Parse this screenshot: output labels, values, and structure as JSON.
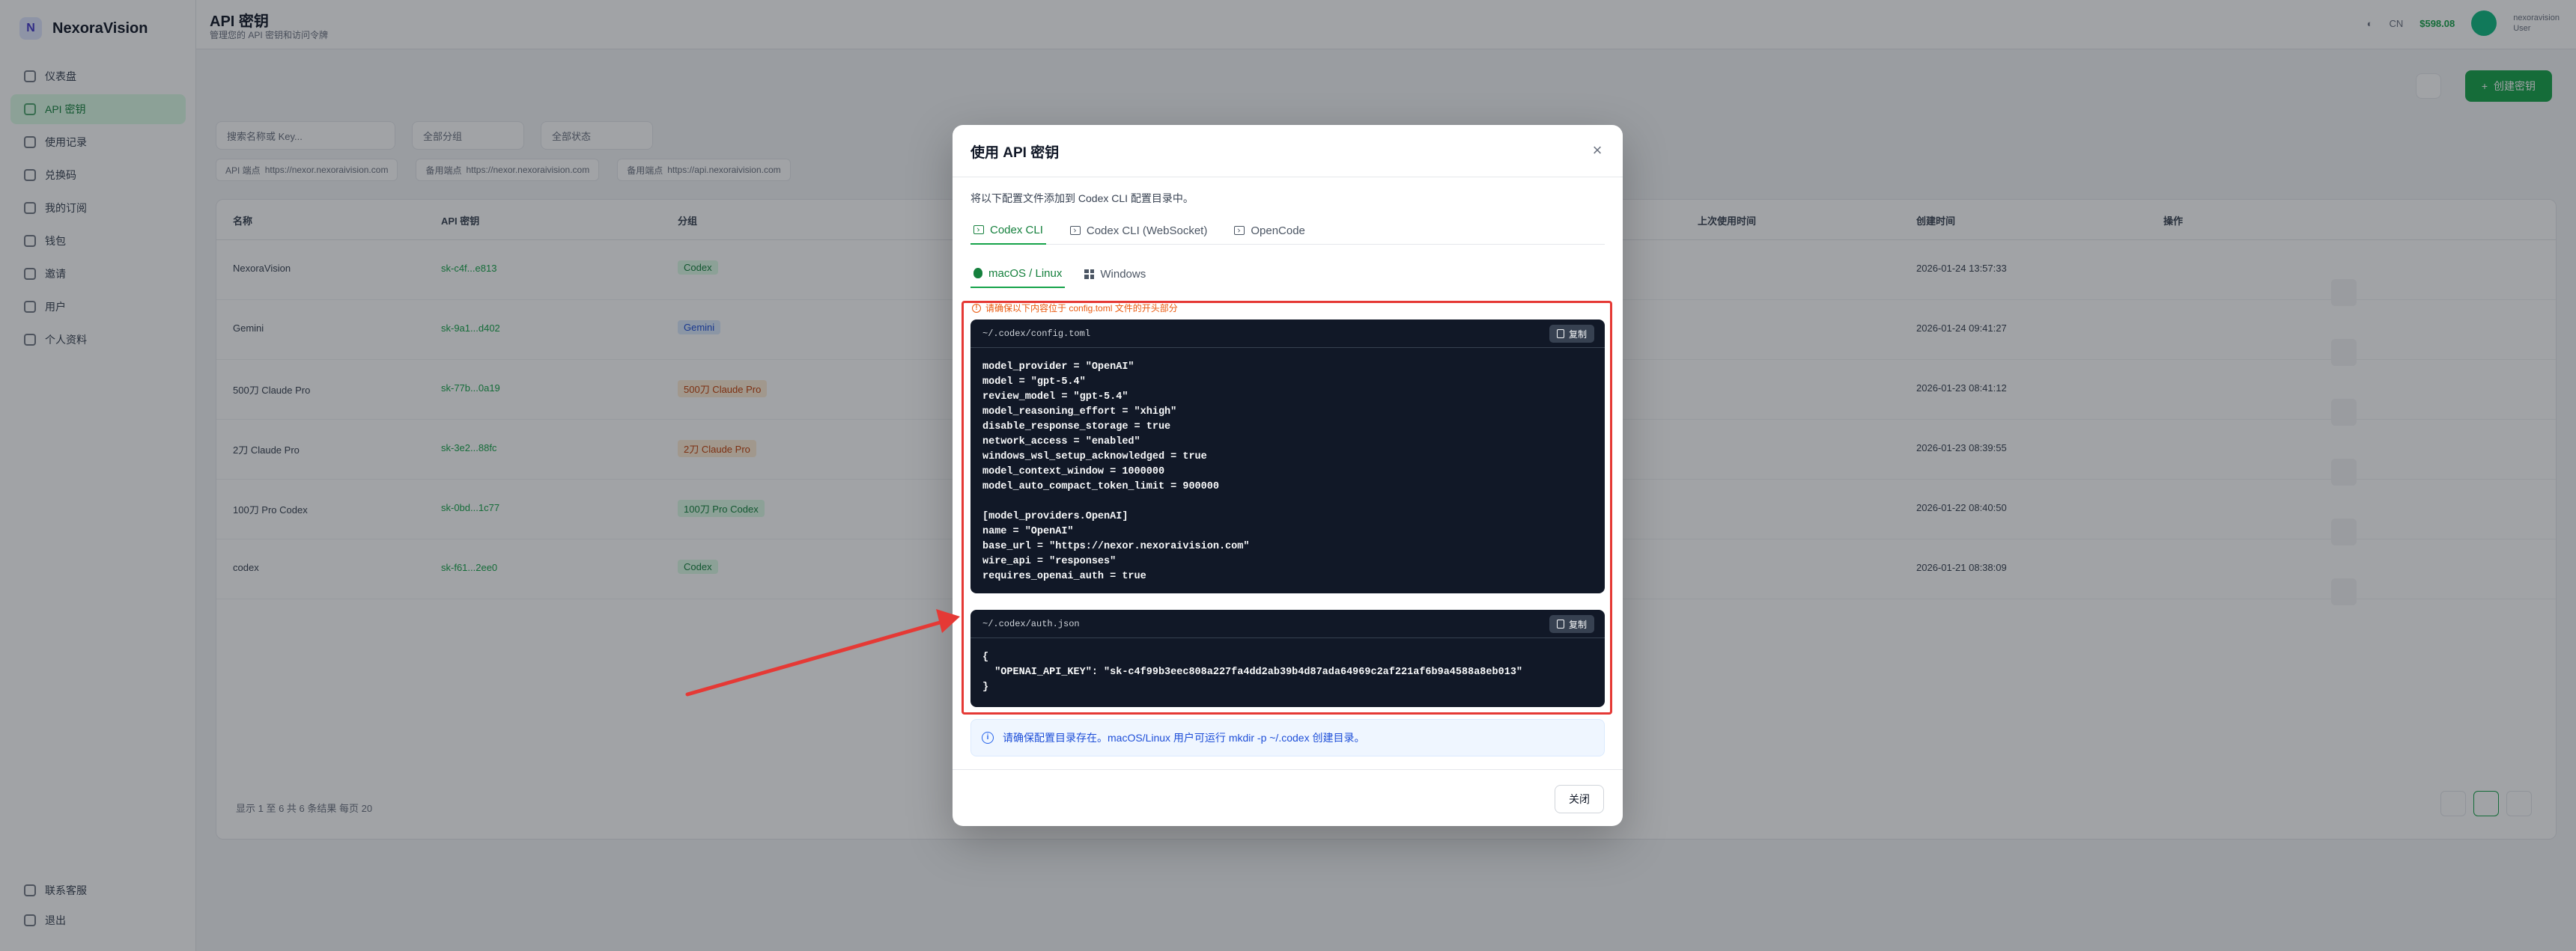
{
  "app": {
    "brand": "NexoraVision",
    "brand_logo": "N",
    "page_title": "API 密钥",
    "page_subtitle": "管理您的 API 密钥和访问令牌",
    "nav": [
      {
        "label": "仪表盘",
        "icon": "dashboard-icon"
      },
      {
        "label": "API 密钥",
        "icon": "key-icon",
        "active": true
      },
      {
        "label": "使用记录",
        "icon": "chart-icon"
      },
      {
        "label": "兑换码",
        "icon": "gift-icon"
      },
      {
        "label": "我的订阅",
        "icon": "card-icon"
      },
      {
        "label": "钱包",
        "icon": "wallet-icon"
      },
      {
        "label": "邀请",
        "icon": "users-icon"
      },
      {
        "label": "用户",
        "icon": "user-icon"
      },
      {
        "label": "个人资料",
        "icon": "profile-icon"
      }
    ],
    "side_bottom": [
      {
        "label": "联系客服",
        "icon": "headset-icon"
      },
      {
        "label": "退出",
        "icon": "logout-icon"
      }
    ],
    "top_right": {
      "lang": "CN",
      "balance": "$598.08",
      "user_name": "nexoravision",
      "user_role": "User"
    },
    "create_button": "创建密钥",
    "filters": [
      "搜索名称或 Key...",
      "全部分组",
      "全部状态"
    ],
    "endpoints": [
      "API 端点",
      "https://nexor.nexoraivision.com",
      "备用端点",
      "https://nexor.nexoraivision.com",
      "备用端点",
      "https://api.nexoraivision.com"
    ],
    "table_headers": [
      "名称",
      "API 密钥",
      "分组",
      "上次使用时间",
      "创建时间",
      "操作"
    ],
    "rows": [
      {
        "name": "NexoraVision",
        "key": "sk-c4f...e813",
        "group": "Codex",
        "tag_color": "green",
        "created": "2026-01-24 13:57:33"
      },
      {
        "name": "Gemini",
        "key": "sk-9a1...d402",
        "group": "Gemini",
        "tag_color": "blue",
        "created": "2026-01-24 09:41:27"
      },
      {
        "name": "500刀 Claude Pro",
        "key": "sk-77b...0a19",
        "group": "500刀 Claude Pro",
        "tag_color": "orange",
        "created": "2026-01-23 08:41:12"
      },
      {
        "name": "2刀 Claude Pro",
        "key": "sk-3e2...88fc",
        "group": "2刀 Claude Pro",
        "tag_color": "orange",
        "created": "2026-01-23 08:39:55"
      },
      {
        "name": "100刀 Pro Codex",
        "key": "sk-0bd...1c77",
        "group": "100刀 Pro Codex",
        "tag_color": "green",
        "created": "2026-01-22 08:40:50"
      },
      {
        "name": "codex",
        "key": "sk-f61...2ee0",
        "group": "Codex",
        "tag_color": "green",
        "created": "2026-01-21 08:38:09"
      }
    ],
    "pager_text": "显示 1 至 6 共 6 条结果    每页    20"
  },
  "modal": {
    "title": "使用 API 密钥",
    "close_glyph": "×",
    "description": "将以下配置文件添加到 Codex CLI 配置目录中。",
    "tabs": [
      {
        "label": "Codex CLI",
        "active": true
      },
      {
        "label": "Codex CLI (WebSocket)",
        "active": false
      },
      {
        "label": "OpenCode",
        "active": false
      }
    ],
    "os_tabs": [
      {
        "label": "macOS / Linux",
        "active": true
      },
      {
        "label": "Windows",
        "active": false
      }
    ],
    "warning": "请确保以下内容位于 config.toml 文件的开头部分",
    "config_file": {
      "path": "~/.codex/config.toml",
      "copy_label": "复制",
      "code": "model_provider = \"OpenAI\"\nmodel = \"gpt-5.4\"\nreview_model = \"gpt-5.4\"\nmodel_reasoning_effort = \"xhigh\"\ndisable_response_storage = true\nnetwork_access = \"enabled\"\nwindows_wsl_setup_acknowledged = true\nmodel_context_window = 1000000\nmodel_auto_compact_token_limit = 900000\n\n[model_providers.OpenAI]\nname = \"OpenAI\"\nbase_url = \"https://nexor.nexoraivision.com\"\nwire_api = \"responses\"\nrequires_openai_auth = true"
    },
    "auth_file": {
      "path": "~/.codex/auth.json",
      "copy_label": "复制",
      "code": "{\n  \"OPENAI_API_KEY\": \"sk-c4f99b3eec808a227fa4dd2ab39b4d87ada64969c2af221af6b9a4588a8eb013\"\n}"
    },
    "info": "请确保配置目录存在。macOS/Linux 用户可运行 mkdir -p ~/.codex 创建目录。",
    "close_button": "关闭"
  },
  "colors": {
    "accent": "#16a34a",
    "annotation": "#e53935",
    "code_bg": "#111827"
  }
}
